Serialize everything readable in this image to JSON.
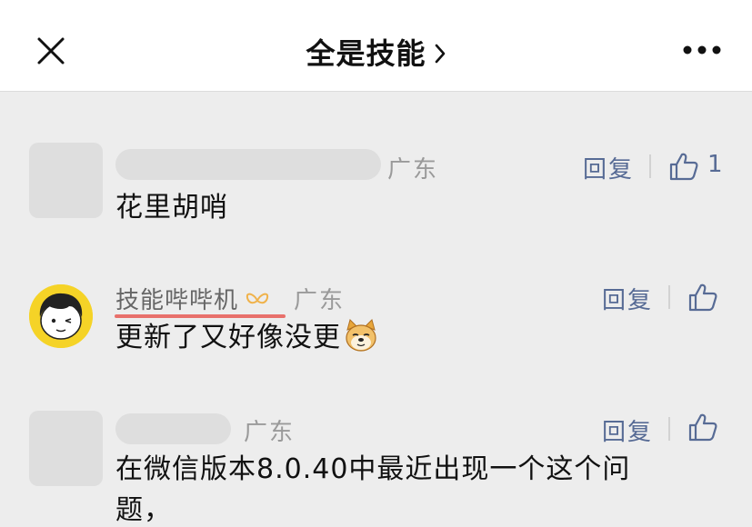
{
  "header": {
    "title": "全是技能",
    "close_icon": "close-icon",
    "chevron_icon": "chevron-right-icon",
    "more_icon": "more-icon"
  },
  "comments": [
    {
      "name": "",
      "region": "广东",
      "reply_label": "回复",
      "like_count": "1",
      "text": "花里胡哨"
    },
    {
      "name": "技能哔哔机",
      "badge_icon": "author-badge-icon",
      "region": "广东",
      "reply_label": "回复",
      "like_count": "",
      "text": "更新了又好像没更",
      "emoji_icon": "doge-emoji-icon"
    },
    {
      "name": "",
      "region": "广东",
      "reply_label": "回复",
      "like_count": "",
      "text_line1": "在微信版本8.0.40中最近出现一个这个问",
      "text_line2": "题，"
    }
  ],
  "colors": {
    "link": "#576b95",
    "secondary_text": "#9a9a9a",
    "author_underline": "#e8706b",
    "page_background": "#ededed"
  }
}
